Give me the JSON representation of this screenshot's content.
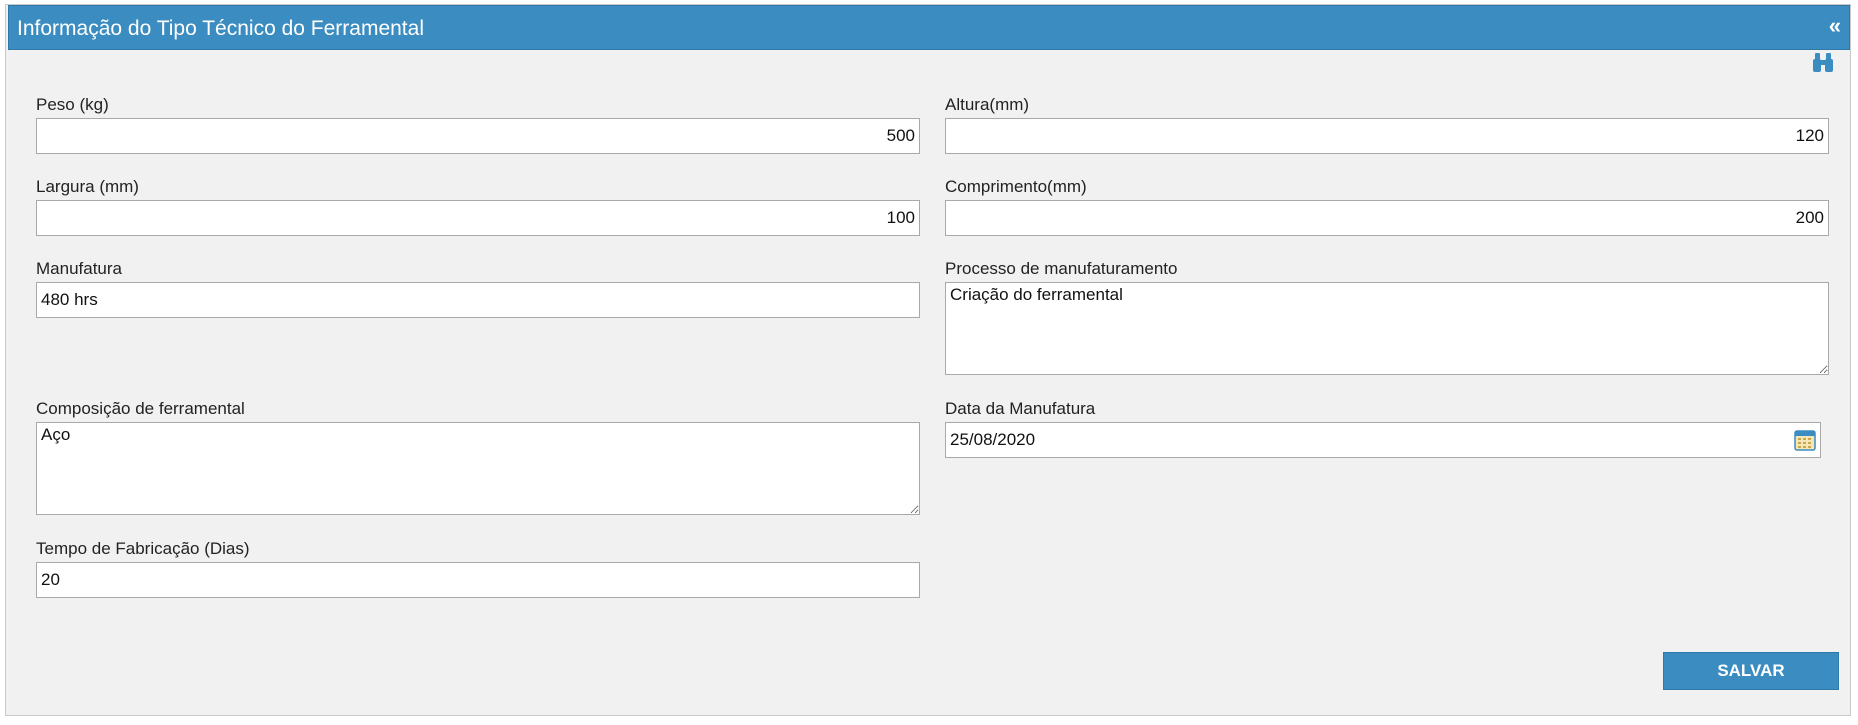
{
  "panel": {
    "title": "Informação do Tipo Técnico do Ferramental",
    "collapse_label": "«"
  },
  "icons": {
    "search": "binoculars-icon",
    "calendar": "calendar-icon"
  },
  "fields": {
    "peso": {
      "label": "Peso (kg)",
      "value": "500"
    },
    "altura": {
      "label": "Altura(mm)",
      "value": "120"
    },
    "largura": {
      "label": "Largura (mm)",
      "value": "100"
    },
    "comprimento": {
      "label": "Comprimento(mm)",
      "value": "200"
    },
    "manufatura": {
      "label": "Manufatura",
      "value": "480 hrs"
    },
    "processo": {
      "label": "Processo de manufaturamento",
      "value": "Criação do ferramental"
    },
    "composicao": {
      "label": "Composição de ferramental",
      "value": "Aço"
    },
    "data": {
      "label": "Data da Manufatura",
      "value": "25/08/2020"
    },
    "tempo": {
      "label": "Tempo de Fabricação (Dias)",
      "value": "20"
    }
  },
  "actions": {
    "save_label": "SALVAR"
  },
  "colors": {
    "header": "#3b8cc0",
    "panel_bg": "#f1f1f1",
    "button": "#3b8cc0"
  }
}
